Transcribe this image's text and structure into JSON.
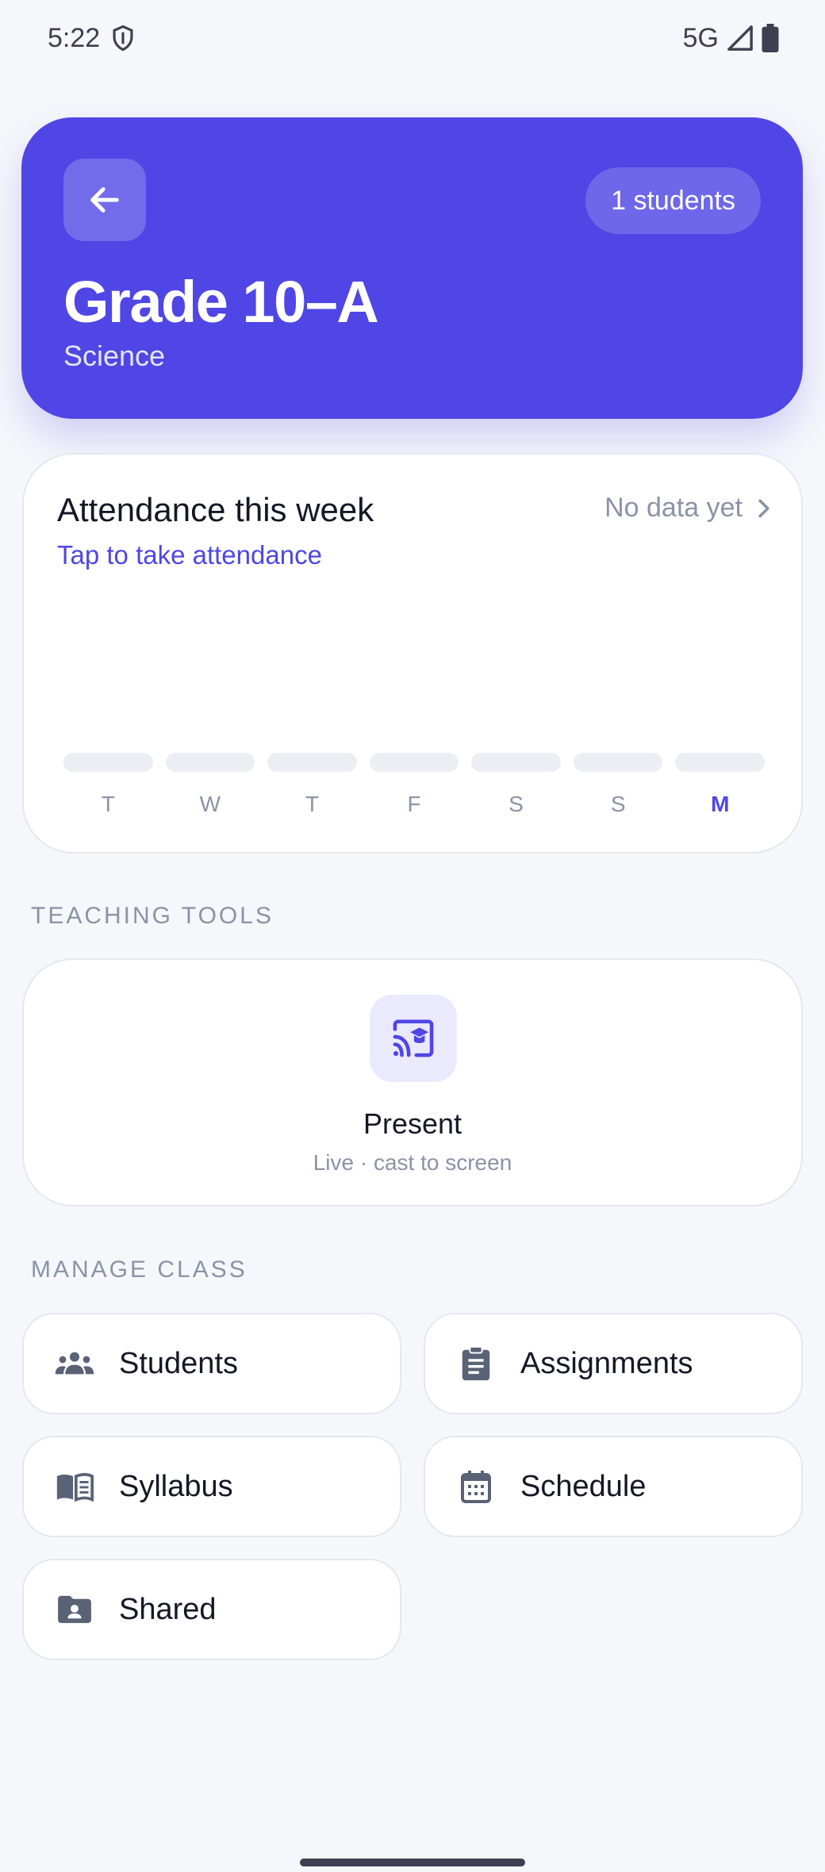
{
  "status_bar": {
    "time": "5:22",
    "network": "5G"
  },
  "header": {
    "class_name": "Grade 10–A",
    "subject": "Science",
    "students_badge": "1 students",
    "accent_color": "#4f46e5"
  },
  "attendance": {
    "title": "Attendance this week",
    "link": "Tap to take attendance",
    "status": "No data yet",
    "days": [
      "T",
      "W",
      "T",
      "F",
      "S",
      "S",
      "M"
    ],
    "active_day_index": 6
  },
  "teaching_tools": {
    "label": "TEACHING TOOLS",
    "present": {
      "title": "Present",
      "subtitle": "Live · cast to screen",
      "icon": "cast-education-icon"
    }
  },
  "manage_class": {
    "label": "MANAGE CLASS",
    "items": [
      {
        "label": "Students",
        "icon": "group-icon"
      },
      {
        "label": "Assignments",
        "icon": "clipboard-icon"
      },
      {
        "label": "Syllabus",
        "icon": "book-icon"
      },
      {
        "label": "Schedule",
        "icon": "calendar-icon"
      },
      {
        "label": "Shared",
        "icon": "shared-folder-icon"
      }
    ]
  }
}
